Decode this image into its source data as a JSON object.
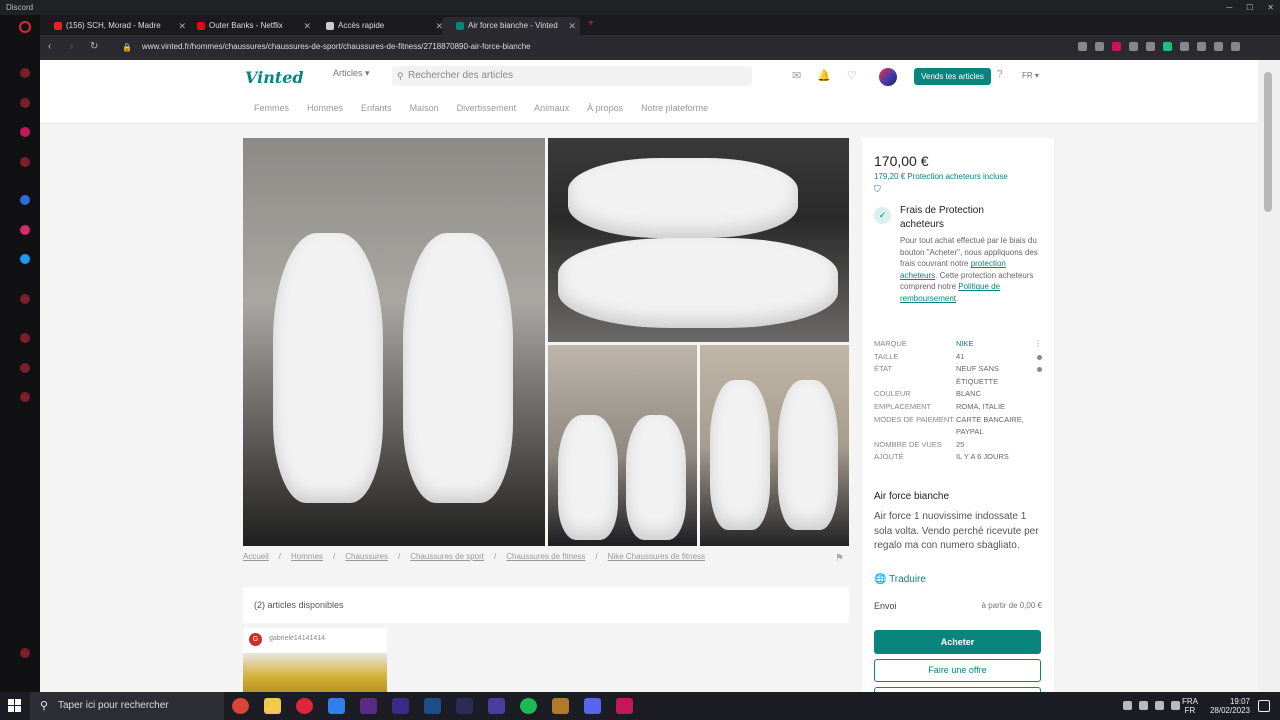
{
  "discord": {
    "title": "Discord"
  },
  "tabs": [
    {
      "label": "(156) SCH, Morad - Madre",
      "fav_color": "#e02424"
    },
    {
      "label": "Outer Banks - Netflix",
      "fav_color": "#e50914"
    },
    {
      "label": "Accès rapide",
      "fav_color": "#cccccc"
    },
    {
      "label": "Air force bianche - Vinted",
      "fav_color": "#09857e"
    }
  ],
  "address": {
    "url": "www.vinted.fr/hommes/chaussures/chaussures-de-sport/chaussures-de-fitness/2718870890-air-force-bianche"
  },
  "header": {
    "logo": "Vinted",
    "category_select": "Articles ▾",
    "search_placeholder": "Rechercher des articles",
    "sell_button": "Vends tes articles",
    "language": "FR ▾"
  },
  "catnav": [
    "Femmes",
    "Hommes",
    "Enfants",
    "Maison",
    "Divertissement",
    "Animaux",
    "À propos",
    "Notre plateforme"
  ],
  "breadcrumb": [
    "Accueil",
    "Hommes",
    "Chaussures",
    "Chaussures de sport",
    "Chaussures de fitness",
    "Nike Chaussures de fitness"
  ],
  "listing": {
    "available": "(2) articles disponibles",
    "seller_initial": "G",
    "seller_name": "gabriele14141414"
  },
  "side": {
    "price": "170,00 €",
    "price_incl": "179,20 € Protection acheteurs incluse",
    "prot_title": "Frais de Protection acheteurs",
    "prot_body_1": "Pour tout achat effectué par le biais du bouton \"Acheter\", nous appliquons des frais couvrant notre ",
    "prot_link_1": "protection acheteurs",
    "prot_body_2": ". Cette protection acheteurs comprend notre ",
    "prot_link_2": "Politique de remboursement",
    "prot_body_3": ".",
    "details": [
      {
        "k": "MARQUE",
        "v": "NIKE",
        "link": true
      },
      {
        "k": "TAILLE",
        "v": "41"
      },
      {
        "k": "ÉTAT",
        "v": "NEUF SANS ÉTIQUETTE"
      },
      {
        "k": "COULEUR",
        "v": "BLANC"
      },
      {
        "k": "EMPLACEMENT",
        "v": "ROMA, ITALIE"
      },
      {
        "k": "MODES DE PAIEMENT",
        "v": "CARTE BANCAIRE, PAYPAL"
      },
      {
        "k": "NOMBRE DE VUES",
        "v": "25"
      },
      {
        "k": "AJOUTÉ",
        "v": "IL Y A 6 JOURS"
      }
    ],
    "desc_title": "Air force bianche",
    "desc": "Air force 1 nuovissime indossate 1 sola volta. Vendo perché ricevute per regalo ma con numero sbagliato.",
    "translate": "Traduire",
    "ship_label": "Envoi",
    "ship_value": "à partir de 0,00 €",
    "buy": "Acheter",
    "offer": "Faire une offre"
  },
  "taskbar": {
    "search": "Taper ici pour rechercher",
    "lang": "FRA",
    "lang2": "FR",
    "time": "19:07",
    "date": "28/02/2023"
  },
  "colors": {
    "accent": "#09857e",
    "background": "#f4f4f4",
    "taskbar": "#1c1c24"
  }
}
